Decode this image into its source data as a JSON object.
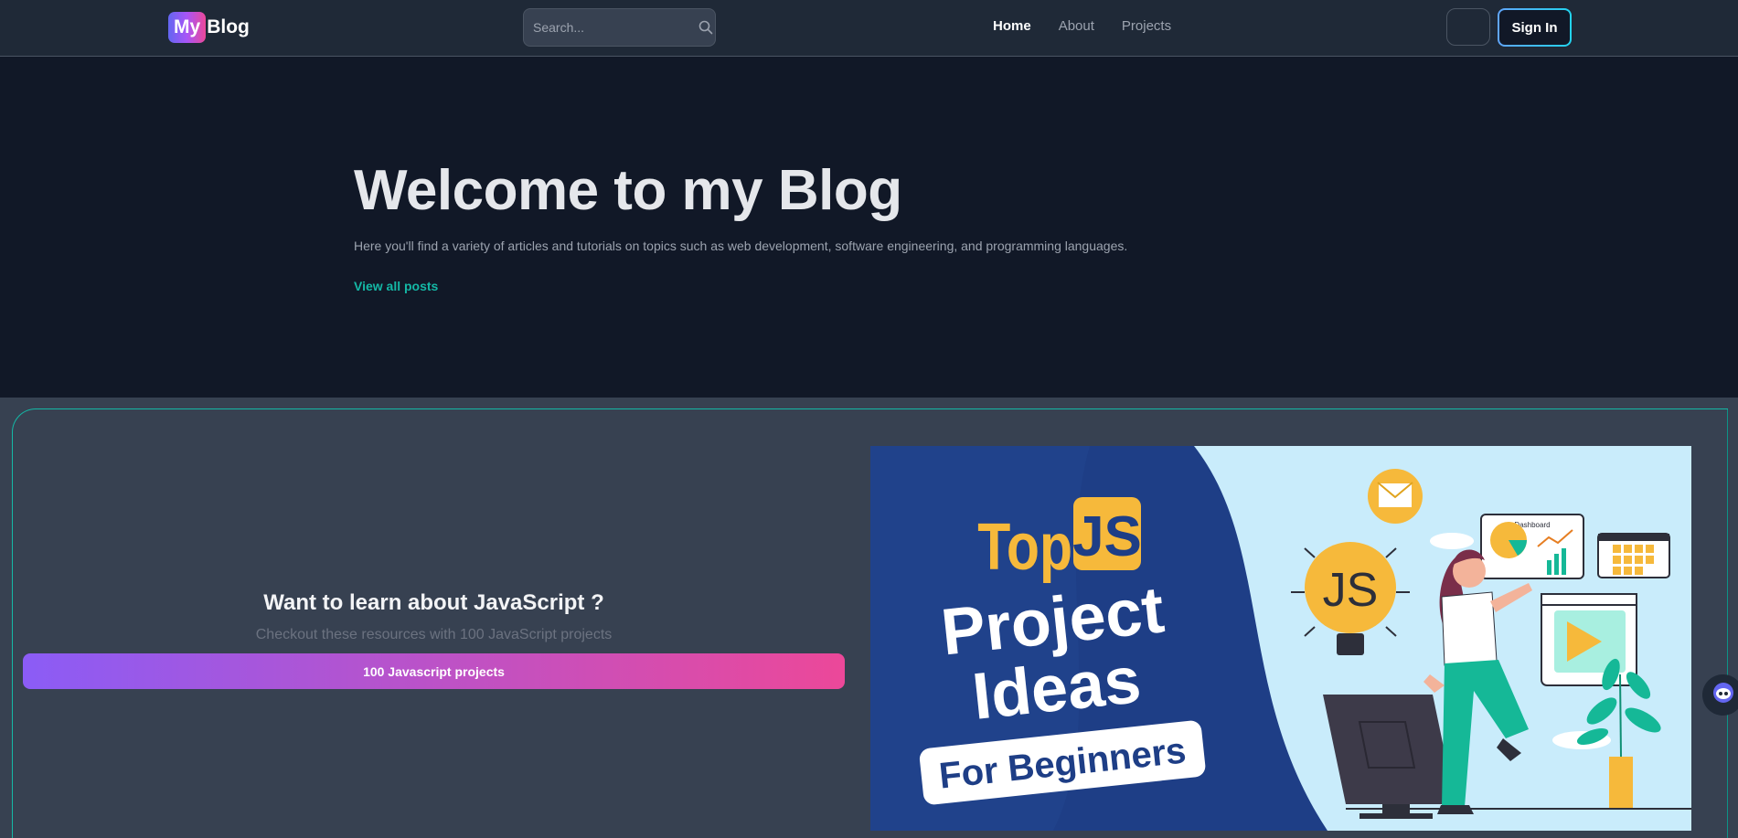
{
  "navbar": {
    "logo_badge": "My",
    "logo_text": "Blog",
    "search_placeholder": "Search...",
    "links": [
      {
        "label": "Home",
        "active": true
      },
      {
        "label": "About",
        "active": false
      },
      {
        "label": "Projects",
        "active": false
      }
    ],
    "theme_icon": "moon-icon",
    "signin_label": "Sign In"
  },
  "hero": {
    "title": "Welcome to my Blog",
    "subtitle": "Here you'll find a variety of articles and tutorials on topics such as web development, software engineering, and programming languages.",
    "link_label": "View all posts"
  },
  "promo": {
    "title": "Want to learn about JavaScript ?",
    "subtitle": "Checkout these resources with 100 JavaScript projects",
    "button_label": "100 Javascript projects",
    "image": {
      "line1_prefix": "Top",
      "line1_badge": "JS",
      "line2": "Project",
      "line3": "Ideas",
      "line4": "For Beginners",
      "bulb_label": "JS",
      "dashboard_label": "Dashboard"
    }
  },
  "colors": {
    "navbar_bg": "#1f2937",
    "hero_bg": "#111827",
    "promo_bg": "#374151",
    "accent_teal": "#14b8a6",
    "gradient_start": "#8b5cf6",
    "gradient_end": "#ec4899"
  },
  "floating_widget_icon": "chat-bot-icon"
}
